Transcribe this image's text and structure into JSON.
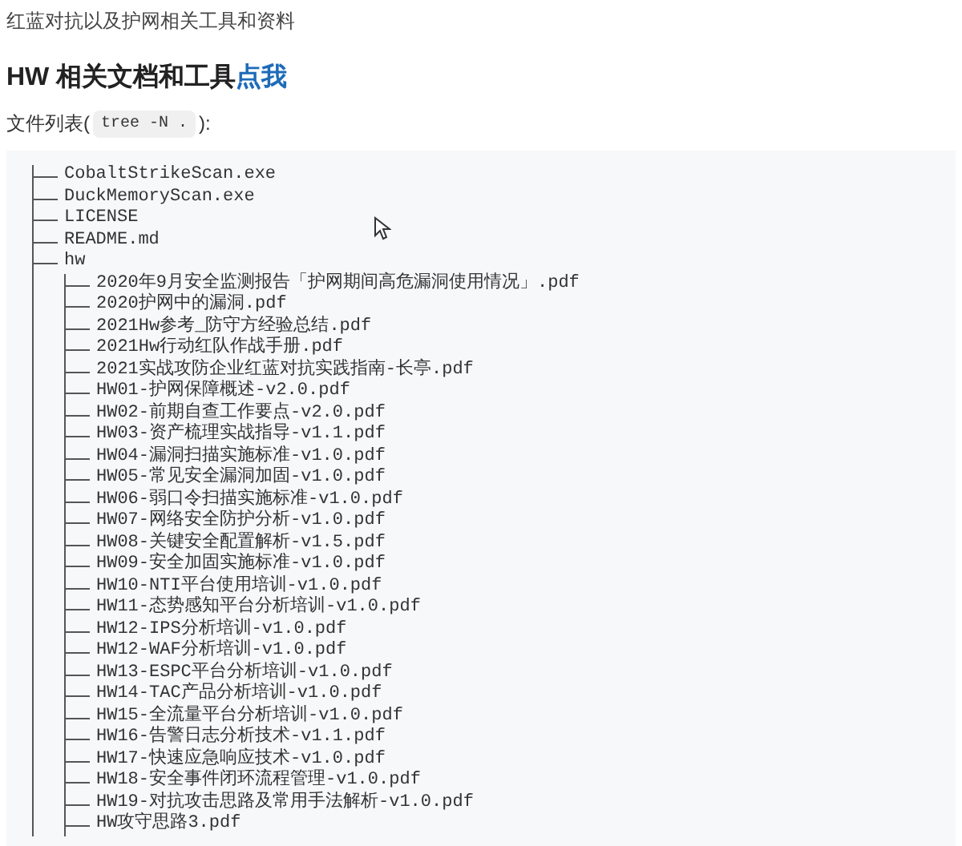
{
  "intro": "红蓝对抗以及护网相关工具和资料",
  "heading": {
    "text": "HW 相关文档和工具",
    "link": "点我"
  },
  "file_list_label": {
    "prefix": "文件列表(",
    "code": "tree -N .",
    "suffix": "):"
  },
  "tree": [
    {
      "name": "CobaltStrikeScan.exe"
    },
    {
      "name": "DuckMemoryScan.exe"
    },
    {
      "name": "LICENSE"
    },
    {
      "name": "README.md"
    },
    {
      "name": "hw",
      "children": [
        {
          "name": "2020年9月安全监测报告「护网期间高危漏洞使用情况」.pdf"
        },
        {
          "name": "2020护网中的漏洞.pdf"
        },
        {
          "name": "2021Hw参考_防守方经验总结.pdf"
        },
        {
          "name": "2021Hw行动红队作战手册.pdf"
        },
        {
          "name": "2021实战攻防企业红蓝对抗实践指南-长亭.pdf"
        },
        {
          "name": "HW01-护网保障概述-v2.0.pdf"
        },
        {
          "name": "HW02-前期自查工作要点-v2.0.pdf"
        },
        {
          "name": "HW03-资产梳理实战指导-v1.1.pdf"
        },
        {
          "name": "HW04-漏洞扫描实施标准-v1.0.pdf"
        },
        {
          "name": "HW05-常见安全漏洞加固-v1.0.pdf"
        },
        {
          "name": "HW06-弱口令扫描实施标准-v1.0.pdf"
        },
        {
          "name": "HW07-网络安全防护分析-v1.0.pdf"
        },
        {
          "name": "HW08-关键安全配置解析-v1.5.pdf"
        },
        {
          "name": "HW09-安全加固实施标准-v1.0.pdf"
        },
        {
          "name": "HW10-NTI平台使用培训-v1.0.pdf"
        },
        {
          "name": "HW11-态势感知平台分析培训-v1.0.pdf"
        },
        {
          "name": "HW12-IPS分析培训-v1.0.pdf"
        },
        {
          "name": "HW12-WAF分析培训-v1.0.pdf"
        },
        {
          "name": "HW13-ESPC平台分析培训-v1.0.pdf"
        },
        {
          "name": "HW14-TAC产品分析培训-v1.0.pdf"
        },
        {
          "name": "HW15-全流量平台分析培训-v1.0.pdf"
        },
        {
          "name": "HW16-告警日志分析技术-v1.1.pdf"
        },
        {
          "name": "HW17-快速应急响应技术-v1.0.pdf"
        },
        {
          "name": "HW18-安全事件闭环流程管理-v1.0.pdf"
        },
        {
          "name": "HW19-对抗攻击思路及常用手法解析-v1.0.pdf"
        },
        {
          "name": "HW攻守思路3.pdf"
        }
      ]
    }
  ]
}
